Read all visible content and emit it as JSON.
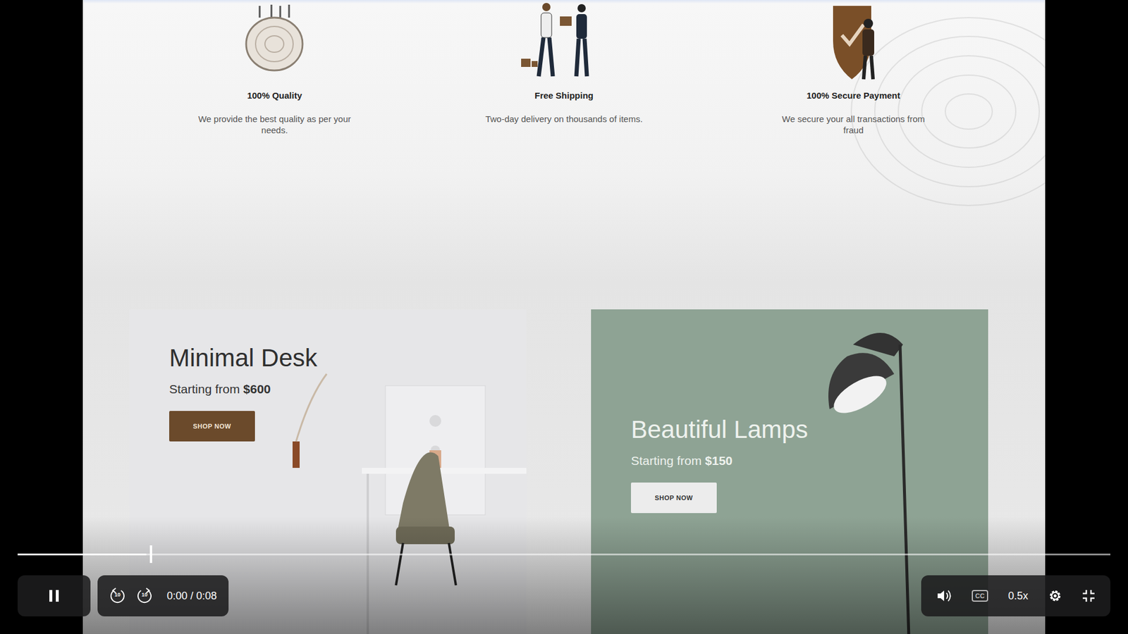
{
  "features": [
    {
      "kind": "quality",
      "title": "100% Quality",
      "text": "We provide the best quality as per your needs."
    },
    {
      "kind": "shipping",
      "title": "Free Shipping",
      "text": "Two-day delivery on thousands of items."
    },
    {
      "kind": "payment",
      "title": "100% Secure Payment",
      "text": "We secure your all transactions from fraud"
    }
  ],
  "cards": [
    {
      "kind": "desk",
      "title": "Minimal Desk",
      "price_label": "Starting from",
      "price": "$600",
      "button": "SHOP NOW"
    },
    {
      "kind": "lamp",
      "title": "Beautiful Lamps",
      "price_label": "Starting from",
      "price": "$150",
      "button": "SHOP NOW"
    }
  ],
  "video": {
    "playing": true,
    "level": 0.118,
    "rewind_label": "10",
    "forward_label": "10",
    "time": "0:00 / 0:08",
    "captions_label": "CC",
    "speed": "0.5x"
  }
}
